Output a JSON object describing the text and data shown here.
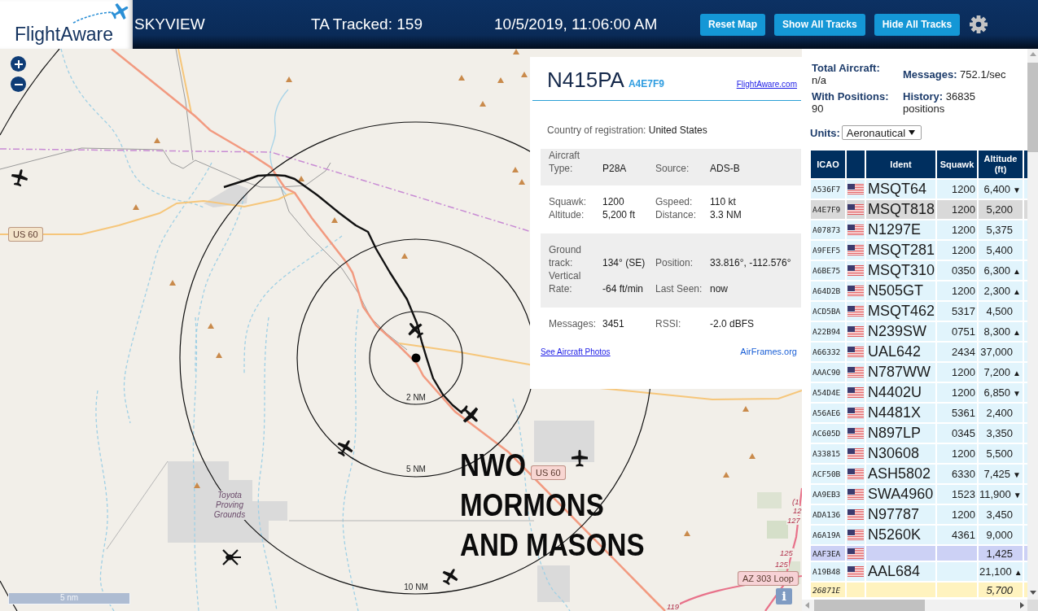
{
  "header": {
    "logo": "FlightAware",
    "title": "SKYVIEW",
    "tracked": "TA Tracked: 159",
    "datetime": "10/5/2019, 11:06:00 AM",
    "buttons": [
      "Reset Map",
      "Show All Tracks",
      "Hide All Tracks"
    ]
  },
  "map": {
    "road_shields": [
      {
        "text": "US 60",
        "color": "#f4e4ca"
      },
      {
        "text": "US 60",
        "color": "#f8d6d2"
      },
      {
        "text": "AZ 303 Loop",
        "color": "#f7d2d6"
      }
    ],
    "route_numbers": [
      "(1",
      "12",
      "127",
      "125",
      "125",
      "119"
    ],
    "range_labels": [
      "2 NM",
      "5 NM",
      "10 NM"
    ],
    "place_labels": [
      "Toyota Proving Grounds"
    ],
    "scale": "5 nm",
    "info_button": "i",
    "annotation": [
      "NWO",
      "MORMONS",
      "AND MASONS"
    ]
  },
  "popup": {
    "ident": "N415PA",
    "hex": "A4E7F9",
    "link": "FlightAware.com",
    "country_label": "Country of registration:",
    "country": "United States",
    "sections": [
      {
        "fields": [
          {
            "label": "Aircraft Type:",
            "value": "P28A"
          },
          {
            "label": "Source:",
            "value": "ADS-B"
          }
        ]
      },
      {
        "fields": [
          {
            "label": "Squawk:",
            "value": "1200"
          },
          {
            "label": "Gspeed:",
            "value": "110 kt"
          },
          {
            "label": "Altitude:",
            "value": "5,200 ft"
          },
          {
            "label": "Distance:",
            "value": "3.3 NM"
          }
        ]
      },
      {
        "fields": [
          {
            "label": "Ground track:",
            "value": "134° (SE)"
          },
          {
            "label": "Position:",
            "value": "33.816°, -112.576°"
          },
          {
            "label": "Vertical Rate:",
            "value": "-64 ft/min"
          },
          {
            "label": "Last Seen:",
            "value": "now"
          }
        ]
      },
      {
        "fields": [
          {
            "label": "Messages:",
            "value": "3451"
          },
          {
            "label": "RSSI:",
            "value": "-2.0 dBFS"
          }
        ]
      }
    ],
    "photos_link": "See Aircraft Photos",
    "airframes_link": "AirFrames.org"
  },
  "stats": [
    "**Total Aircraft:** n/a",
    "**Messages:** 752.1/sec",
    "**With Positions:** 90",
    "**History:** 36835 positions"
  ],
  "units": {
    "label": "Units:",
    "value": "Aeronautical"
  },
  "table": {
    "columns": [
      "ICAO",
      "Ident",
      "Squawk",
      "Altitude (ft)"
    ],
    "rows": [
      {
        "icao": "A536F7",
        "flag": true,
        "ident": "MSQT64",
        "squawk": "1200",
        "altitude": "6,400",
        "trend": "▼",
        "selected": false,
        "kind": "normal",
        "color": "#e1f4fc"
      },
      {
        "icao": "A4E7F9",
        "flag": true,
        "ident": "MSQT818",
        "squawk": "1200",
        "altitude": "5,200",
        "selected": true,
        "kind": "normal"
      },
      {
        "icao": "A07873",
        "flag": true,
        "ident": "N1297E",
        "squawk": "1200",
        "altitude": "5,375",
        "selected": false,
        "kind": "normal",
        "color": "#e1f4fc"
      },
      {
        "icao": "A9FEF5",
        "flag": true,
        "ident": "MSQT281",
        "squawk": "1200",
        "altitude": "5,400",
        "selected": false,
        "kind": "normal",
        "color": "#e1f4fc"
      },
      {
        "icao": "A6BE75",
        "flag": true,
        "ident": "MSQT310",
        "squawk": "0350",
        "altitude": "6,300",
        "trend": "▲",
        "selected": false,
        "kind": "normal",
        "color": "#e1f4fc"
      },
      {
        "icao": "A64D2B",
        "flag": true,
        "ident": "N505GT",
        "squawk": "1200",
        "altitude": "2,300",
        "trend": "▲",
        "selected": false,
        "kind": "normal",
        "color": "#e1f4fc"
      },
      {
        "icao": "ACD5BA",
        "flag": true,
        "ident": "MSQT462",
        "squawk": "5317",
        "altitude": "4,500",
        "selected": false,
        "kind": "normal",
        "color": "#e1f4fc"
      },
      {
        "icao": "A22B94",
        "flag": true,
        "ident": "N239SW",
        "squawk": "0751",
        "altitude": "8,300",
        "trend": "▲",
        "selected": false,
        "kind": "normal",
        "color": "#e1f4fc"
      },
      {
        "icao": "A66332",
        "flag": true,
        "ident": "UAL642",
        "squawk": "2434",
        "altitude": "37,000",
        "selected": false,
        "kind": "normal",
        "color": "#e1f4fc"
      },
      {
        "icao": "AAAC90",
        "flag": true,
        "ident": "N787WW",
        "squawk": "1200",
        "altitude": "7,200",
        "trend": "▲",
        "selected": false,
        "kind": "normal",
        "color": "#e1f4fc"
      },
      {
        "icao": "A54D4E",
        "flag": true,
        "ident": "N4402U",
        "squawk": "1200",
        "altitude": "6,850",
        "trend": "▼",
        "selected": false,
        "kind": "normal",
        "color": "#e1f4fc"
      },
      {
        "icao": "A56AE6",
        "flag": true,
        "ident": "N4481X",
        "squawk": "5361",
        "altitude": "2,400",
        "selected": false,
        "kind": "normal",
        "color": "#e1f4fc"
      },
      {
        "icao": "AC605D",
        "flag": true,
        "ident": "N897LP",
        "squawk": "0345",
        "altitude": "3,350",
        "selected": false,
        "kind": "normal",
        "color": "#e1f4fc"
      },
      {
        "icao": "A33815",
        "flag": true,
        "ident": "N30608",
        "squawk": "1200",
        "altitude": "5,500",
        "selected": false,
        "kind": "normal",
        "color": "#e1f4fc"
      },
      {
        "icao": "ACF50B",
        "flag": true,
        "ident": "ASH5802",
        "squawk": "6330",
        "altitude": "7,425",
        "trend": "▼",
        "selected": false,
        "kind": "normal",
        "color": "#e1f4fc"
      },
      {
        "icao": "AA9EB3",
        "flag": true,
        "ident": "SWA4960",
        "squawk": "1523",
        "altitude": "11,900",
        "trend": "▼",
        "selected": false,
        "kind": "normal",
        "color": "#e1f4fc"
      },
      {
        "icao": "ADA136",
        "flag": true,
        "ident": "N97787",
        "squawk": "1200",
        "altitude": "3,450",
        "selected": false,
        "kind": "normal",
        "color": "#e1f4fc"
      },
      {
        "icao": "A6A19A",
        "flag": true,
        "ident": "N5260K",
        "squawk": "4361",
        "altitude": "9,000",
        "selected": false,
        "kind": "normal",
        "color": "#e1f4fc"
      },
      {
        "icao": "AAF3EA",
        "flag": true,
        "altitude": "1,425",
        "selected": false,
        "kind": "normal",
        "color": "#ccd1f5"
      },
      {
        "icao": "A19B48",
        "flag": true,
        "ident": "AAL684",
        "altitude": "21,100",
        "trend": "▲",
        "selected": false,
        "kind": "normal",
        "color": "#e1f4fc"
      },
      {
        "icao": "26871E",
        "flag": false,
        "altitude": "5,700",
        "selected": false,
        "kind": "italic",
        "color": "#fff3bf"
      }
    ]
  }
}
